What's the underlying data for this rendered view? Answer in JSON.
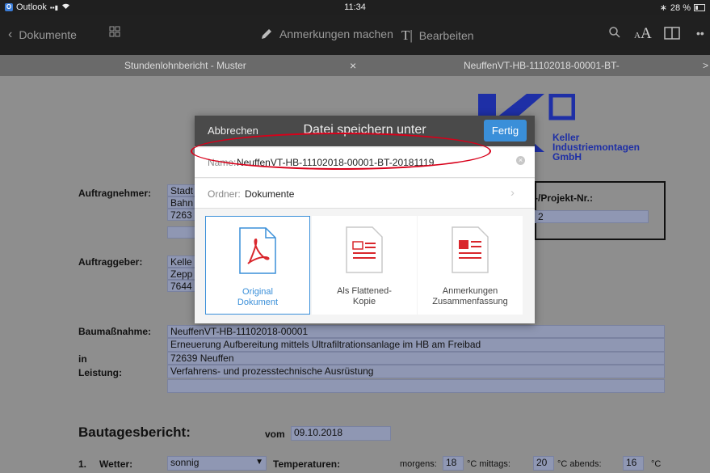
{
  "status": {
    "app": "Outlook",
    "time": "11:34",
    "battery": "28 %"
  },
  "toolbar": {
    "back_label": "Dokumente",
    "annotate_label": "Anmerkungen machen",
    "edit_label": "Bearbeiten",
    "more_label": "••"
  },
  "tabs": [
    {
      "title": "Stundenlohnbericht - Muster",
      "close": "×"
    },
    {
      "title": "NeuffenVT-HB-11102018-00001-BT-",
      "close": ">"
    }
  ],
  "logo": {
    "line1": "Keller",
    "line2": "Industriemontagen",
    "line3": "GmbH"
  },
  "form": {
    "auftragnehmer_label": "Auftragnehmer:",
    "an_lines": [
      "Stadt",
      "Bahn",
      "7263"
    ],
    "projekt_label": "-/Projekt-Nr.:",
    "projekt_value": "2",
    "auftraggeber_label": "Auftraggeber:",
    "ag_lines": [
      "Kelle",
      "Zepp",
      "7644"
    ],
    "baumassnahme_label": "Baumaßnahme:",
    "in_label": "in",
    "leistung_label": "Leistung:",
    "bm_lines": [
      "NeuffenVT-HB-11102018-00001",
      "Erneuerung Aufbereitung mittels Ultrafiltrationsanlage im HB am Freibad",
      "72639 Neuffen",
      "Verfahrens- und prozesstechnische Ausrüstung"
    ],
    "bautagesbericht_label": "Bautagesbericht:",
    "vom_label": "vom",
    "vom_value": "09.10.2018",
    "wetter_num": "1.",
    "wetter_label": "Wetter:",
    "wetter_value": "sonnig",
    "temperaturen_label": "Temperaturen:",
    "morgens_label": "morgens:",
    "morgens_value": "18",
    "c1": "°C mittags:",
    "mittags_value": "20",
    "c2": "°C abends:",
    "abends_value": "16",
    "c3": "°C"
  },
  "dialog": {
    "cancel_label": "Abbrechen",
    "title": "Datei speichern unter",
    "done_label": "Fertig",
    "name_label": "Name:",
    "name_value": "NeuffenVT-HB-11102018-00001-BT-20181119",
    "folder_label": "Ordner:",
    "folder_value": "Dokumente",
    "options": [
      {
        "line1": "Original",
        "line2": "Dokument",
        "icon": "pdf-icon",
        "color": "#3a8fd9"
      },
      {
        "line1": "Als Flattened-",
        "line2": "Kopie",
        "icon": "flattened-doc-icon",
        "color": "#444444"
      },
      {
        "line1": "Anmerkungen",
        "line2": "Zusammenfassung",
        "icon": "annotation-summary-icon",
        "color": "#444444"
      }
    ]
  },
  "colors": {
    "accent": "#3a8fd9",
    "highlight_circle": "#d8001a",
    "pdf_red": "#d9262c",
    "field_blue": "#8f97b3"
  }
}
